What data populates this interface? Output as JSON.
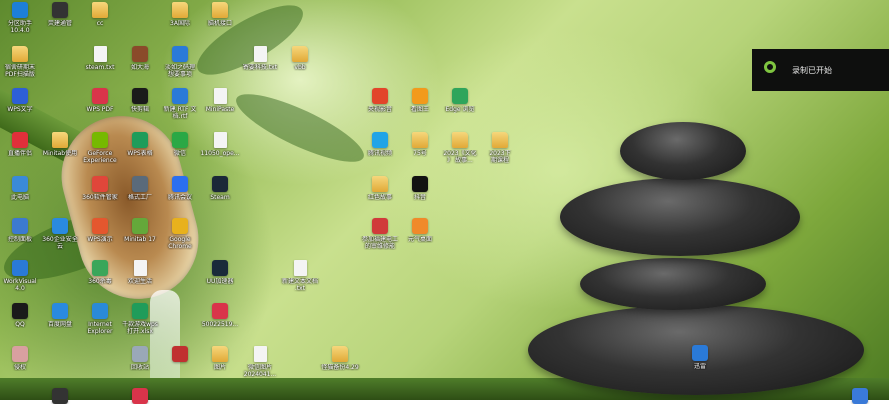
{
  "toast": {
    "message": "录制已开始",
    "accent": "#7fc540"
  },
  "icons": [
    {
      "label": "分区助手\n10.4.0",
      "color": "#1d7fd8",
      "glyph": "app"
    },
    {
      "label": "荧建通管",
      "color": "#333333",
      "glyph": "app"
    },
    {
      "label": "cc",
      "color": "",
      "glyph": "folder"
    },
    {
      "label": "3A国际",
      "color": "",
      "glyph": "folder"
    },
    {
      "label": "脑机接口",
      "color": "",
      "glyph": "folder"
    },
    {
      "label": "宿舍研期末\nPDF扫描版",
      "color": "",
      "glyph": "folder"
    },
    {
      "label": "steam.txt",
      "color": "",
      "glyph": "file"
    },
    {
      "label": "如大海",
      "color": "#8a4a2a",
      "glyph": "app"
    },
    {
      "label": "淡如之码理\n想要事项",
      "color": "#2a7ad8",
      "glyph": "app"
    },
    {
      "label": "寄要科技.txt",
      "color": "",
      "glyph": "file"
    },
    {
      "label": "vbb",
      "color": "",
      "glyph": "folder"
    },
    {
      "label": "WPS文字",
      "color": "#2d5fd6",
      "glyph": "app"
    },
    {
      "label": "WPS PDF",
      "color": "#d9344a",
      "glyph": "app"
    },
    {
      "label": "快剪辑",
      "color": "#1a1a1a",
      "glyph": "app"
    },
    {
      "label": "新建 RTF 文\n档.rtf",
      "color": "#2a7ad8",
      "glyph": "app"
    },
    {
      "label": "MiniPaste",
      "color": "",
      "glyph": "file"
    },
    {
      "label": "央视影音",
      "color": "#e2452a",
      "glyph": "app"
    },
    {
      "label": "看图王",
      "color": "#f29a1c",
      "glyph": "app"
    },
    {
      "label": "Edge 浏览",
      "color": "#2fa55b",
      "glyph": "app"
    },
    {
      "label": "直播伴侣",
      "color": "#e0303a",
      "glyph": "app"
    },
    {
      "label": "Minitab使用",
      "color": "",
      "glyph": "folder"
    },
    {
      "label": "GeForce\nExperience",
      "color": "#76b900",
      "glyph": "app"
    },
    {
      "label": "WPS表格",
      "color": "#1f9c5a",
      "glyph": "app"
    },
    {
      "label": "微信",
      "color": "#2aa845",
      "glyph": "app"
    },
    {
      "label": "11050_ope...",
      "color": "",
      "glyph": "file"
    },
    {
      "label": "腾讯视频",
      "color": "#20a4e6",
      "glyph": "app"
    },
    {
      "label": "75号",
      "color": "",
      "glyph": "folder"
    },
    {
      "label": "2023《文化\n》 故事...",
      "color": "",
      "glyph": "folder"
    },
    {
      "label": "2023下\n期课程",
      "color": "",
      "glyph": "folder"
    },
    {
      "label": "此电脑",
      "color": "#3a8ad8",
      "glyph": "app"
    },
    {
      "label": "360软件管家",
      "color": "#e0463a",
      "glyph": "app"
    },
    {
      "label": "格式工厂",
      "color": "#5a6a7a",
      "glyph": "app"
    },
    {
      "label": "腾讯会议",
      "color": "#2b6ff0",
      "glyph": "app"
    },
    {
      "label": "Steam",
      "color": "#1b2838",
      "glyph": "app"
    },
    {
      "label": "红色故事",
      "color": "",
      "glyph": "folder"
    },
    {
      "label": "抖音",
      "color": "#111111",
      "glyph": "app"
    },
    {
      "label": "控制面板",
      "color": "#3c7ad0",
      "glyph": "app"
    },
    {
      "label": "360企业安全\n云",
      "color": "#2a8ae0",
      "glyph": "app"
    },
    {
      "label": "WPS演示",
      "color": "#e4572e",
      "glyph": "app"
    },
    {
      "label": "Minitab 17",
      "color": "#64a83a",
      "glyph": "app"
    },
    {
      "label": "Google\nChrome",
      "color": "#e8b11c",
      "glyph": "app"
    },
    {
      "label": "参加福建电工\n的审维修能",
      "color": "#d03a3a",
      "glyph": "app"
    },
    {
      "label": "元气桌面",
      "color": "#f08a2a",
      "glyph": "app"
    },
    {
      "label": "WorkVisual\n4.0",
      "color": "#2a7ad8",
      "glyph": "app"
    },
    {
      "label": "360杀毒",
      "color": "#3aa65a",
      "glyph": "app"
    },
    {
      "label": "欢迎生活",
      "color": "",
      "glyph": "file"
    },
    {
      "label": "UU加速器",
      "color": "#1a2a3a",
      "glyph": "app"
    },
    {
      "label": "新建文本文档\n.txt",
      "color": "",
      "glyph": "file"
    },
    {
      "label": "QQ",
      "color": "#1a1a1a",
      "glyph": "app"
    },
    {
      "label": "百度网盘",
      "color": "#2a8ae0",
      "glyph": "app"
    },
    {
      "label": "Internet\nExplorer",
      "color": "#2a8ad8",
      "glyph": "app"
    },
    {
      "label": "千款游戏wps\n打开.xlsx",
      "color": "#1f9c5a",
      "glyph": "app"
    },
    {
      "label": "50022519...",
      "color": "#d9344a",
      "glyph": "app"
    },
    {
      "label": "迅雷",
      "color": "#2a7ad8",
      "glyph": "app"
    },
    {
      "label": "侵权",
      "color": "#d8a0a0",
      "glyph": "app"
    },
    {
      "label": "回收站",
      "color": "#9aa8b8",
      "glyph": "app"
    },
    {
      "label": "",
      "color": "#c03030",
      "glyph": "app"
    },
    {
      "label": "图片",
      "color": "",
      "glyph": "folder"
    },
    {
      "label": "微信图片\n2024041...",
      "color": "",
      "glyph": "file"
    },
    {
      "label": "怪猫备份4.29",
      "color": "",
      "glyph": "folder"
    },
    {
      "label": "",
      "color": "#333333",
      "glyph": "app"
    },
    {
      "label": "",
      "color": "#d9344a",
      "glyph": "app"
    },
    {
      "label": "",
      "color": "#3a7ad8",
      "glyph": "app"
    }
  ]
}
